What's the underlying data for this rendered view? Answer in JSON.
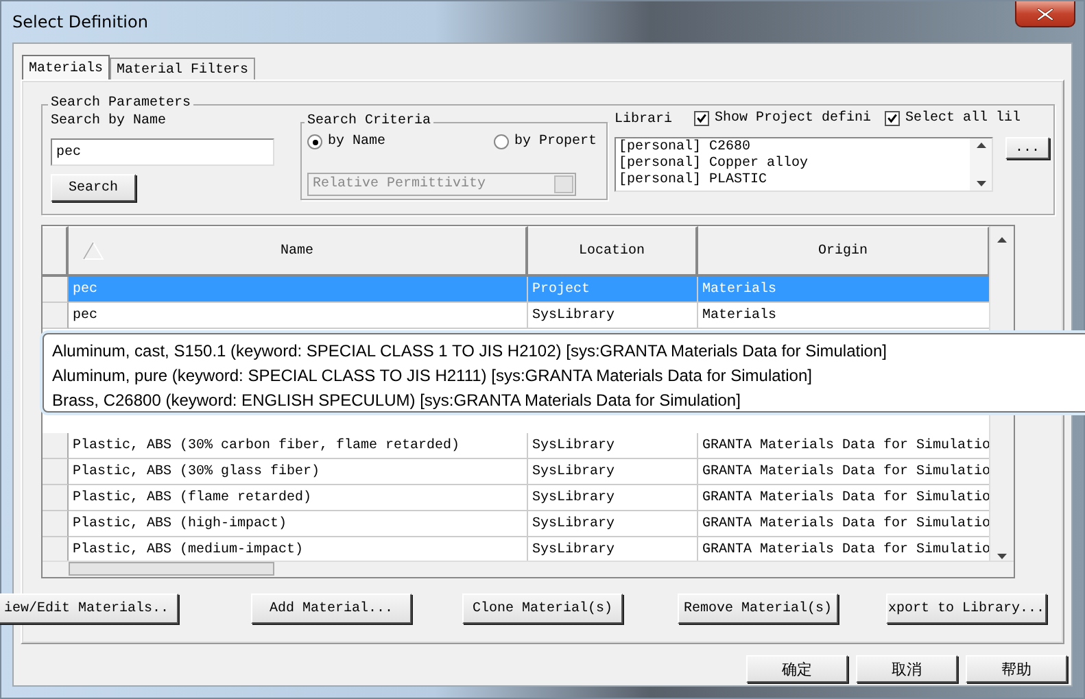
{
  "window": {
    "title": "Select Definition"
  },
  "tabs": [
    {
      "label": "Materials",
      "selected": true
    },
    {
      "label": "Material Filters",
      "selected": false
    }
  ],
  "search_parameters": {
    "title": "Search Parameters",
    "name_label": "Search by Name",
    "name_value": "pec",
    "search_button": "Search"
  },
  "search_criteria": {
    "title": "Search Criteria",
    "options": [
      {
        "label": "by Name",
        "selected": true
      },
      {
        "label": "by Propert",
        "selected": false
      }
    ],
    "property_dropdown": {
      "value": "Relative Permittivity",
      "disabled": true
    }
  },
  "libraries": {
    "label": "Librari",
    "checkboxes": [
      {
        "label": "Show Project defini",
        "checked": true
      },
      {
        "label": "Select all lil",
        "checked": true
      }
    ],
    "items": [
      "[personal] C2680",
      "[personal] Copper alloy",
      "[personal] PLASTIC"
    ],
    "browse_button": "..."
  },
  "table": {
    "columns": [
      "Name",
      "Location",
      "Origin"
    ],
    "rows": [
      {
        "cells": [
          "pec",
          "Project",
          "Materials"
        ],
        "selected": true
      },
      {
        "cells": [
          "pec",
          "SysLibrary",
          "Materials"
        ],
        "selected": false
      },
      {
        "cells": [
          "Plastic, ABS (30% carbon fiber, flame retarded)",
          "SysLibrary",
          "GRANTA Materials Data for Simulatio"
        ],
        "selected": false
      },
      {
        "cells": [
          "Plastic, ABS (30% glass fiber)",
          "SysLibrary",
          "GRANTA Materials Data for Simulatio"
        ],
        "selected": false
      },
      {
        "cells": [
          "Plastic, ABS (flame retarded)",
          "SysLibrary",
          "GRANTA Materials Data for Simulatio"
        ],
        "selected": false
      },
      {
        "cells": [
          "Plastic, ABS (high-impact)",
          "SysLibrary",
          "GRANTA Materials Data for Simulatio"
        ],
        "selected": false
      },
      {
        "cells": [
          "Plastic, ABS (medium-impact)",
          "SysLibrary",
          "GRANTA Materials Data for Simulatio"
        ],
        "selected": false
      }
    ]
  },
  "tooltip": {
    "lines": [
      "Aluminum, cast, S150.1 (keyword: SPECIAL CLASS 1 TO JIS H2102) [sys:GRANTA Materials Data for Simulation]",
      "Aluminum, pure (keyword: SPECIAL CLASS TO JIS H2111) [sys:GRANTA Materials Data for Simulation]",
      "Brass, C26800 (keyword: ENGLISH SPECULUM) [sys:GRANTA Materials Data for Simulation]"
    ]
  },
  "action_buttons": [
    "iew/Edit Materials..",
    "Add Material...",
    "Clone Material(s)",
    "Remove Material(s)",
    "xport to Library..."
  ],
  "dialog_buttons": [
    "确定",
    "取消",
    "帮助"
  ]
}
